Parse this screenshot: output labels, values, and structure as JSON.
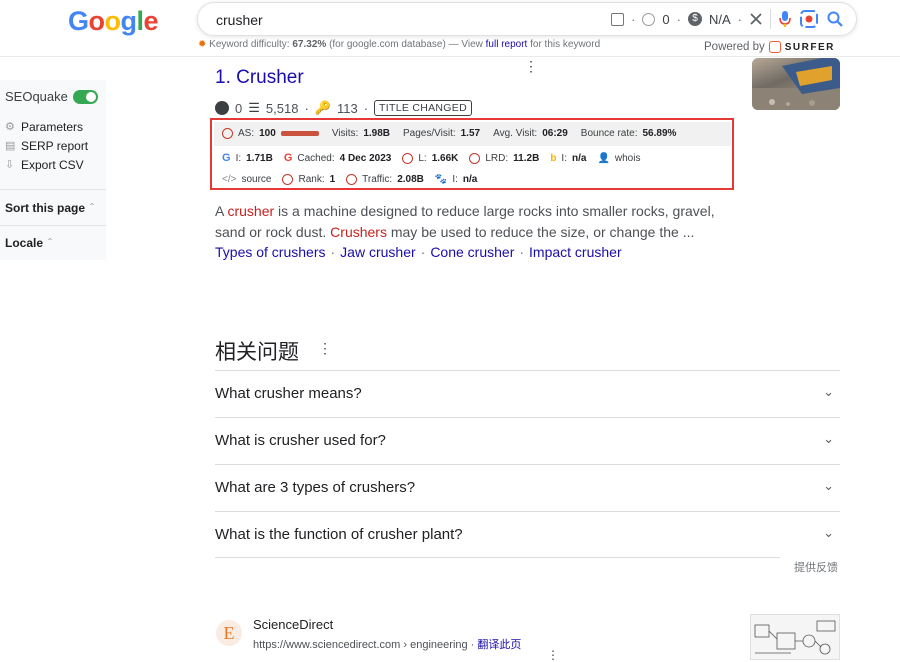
{
  "logo": {
    "letters": [
      "G",
      "o",
      "o",
      "g",
      "l",
      "e"
    ],
    "colors": [
      "#4285f4",
      "#ea4335",
      "#fbbc05",
      "#4285f4",
      "#34a853",
      "#ea4335"
    ]
  },
  "search": {
    "query": "crusher",
    "count": "0",
    "value": "N/A"
  },
  "keyword_bar": {
    "prefix": "Keyword difficulty:",
    "difficulty": "67.32%",
    "db_note": "(for google.com database) — View",
    "link": "full report",
    "suffix": "for this keyword"
  },
  "powered": {
    "label": "Powered by",
    "brand": "SURFER"
  },
  "sidebar": {
    "seoquake": "SEOquake",
    "items": [
      {
        "icon": "gear-icon",
        "label": "Parameters"
      },
      {
        "icon": "report-icon",
        "label": "SERP report"
      },
      {
        "icon": "export-icon",
        "label": "Export CSV"
      }
    ],
    "sort": "Sort this page",
    "locale": "Locale"
  },
  "result": {
    "title": "1. Crusher",
    "comments": "0",
    "links": "5,518",
    "keys": "113",
    "badge": "TITLE CHANGED",
    "snippet_pre": "A ",
    "snippet_hl1": "crusher",
    "snippet_mid": " is a machine designed to reduce large rocks into smaller rocks, gravel, sand or rock dust. ",
    "snippet_hl2": "Crushers",
    "snippet_post": " may be used to reduce the size, or change the ...",
    "sitelinks": [
      "Types of crushers",
      "Jaw crusher",
      "Cone crusher",
      "Impact crusher"
    ]
  },
  "seo": {
    "row1": {
      "as_label": "AS:",
      "as_value": "100",
      "as_fill": 1.0,
      "visits_label": "Visits:",
      "visits": "1.98B",
      "pages_label": "Pages/Visit:",
      "pages": "1.57",
      "avg_label": "Avg. Visit:",
      "avg": "06:29",
      "bounce_label": "Bounce rate:",
      "bounce": "56.89%"
    },
    "row2": {
      "i_label": "I:",
      "i_value": "1.71B",
      "cached_label": "Cached:",
      "cached": "4 Dec 2023",
      "l_label": "L:",
      "l_value": "1.66K",
      "lrd_label": "LRD:",
      "lrd": "11.2B",
      "bi_label": "I:",
      "bi_value": "n/a",
      "whois": "whois"
    },
    "row3": {
      "source": "source",
      "rank_label": "Rank:",
      "rank": "1",
      "traffic_label": "Traffic:",
      "traffic": "2.08B",
      "baidu_label": "I:",
      "baidu_value": "n/a"
    }
  },
  "paa": {
    "title": "相关问题",
    "questions": [
      "What crusher means?",
      "What is crusher used for?",
      "What are 3 types of crushers?",
      "What is the function of crusher plant?"
    ],
    "feedback": "提供反馈"
  },
  "next_result": {
    "site": "ScienceDirect",
    "url": "https://www.sciencedirect.com",
    "path": "› engineering ·",
    "translate": "翻译此页"
  }
}
